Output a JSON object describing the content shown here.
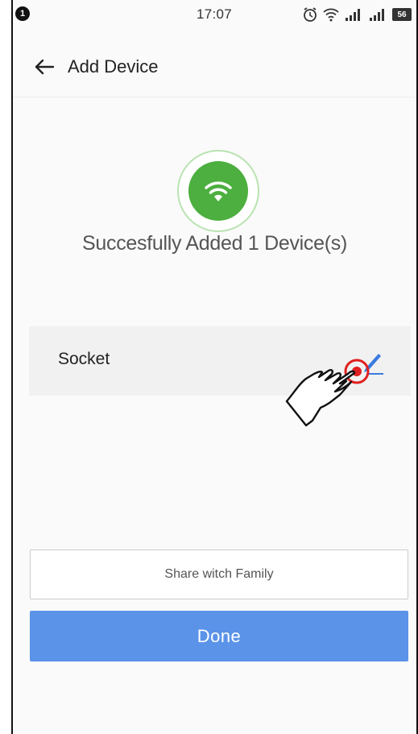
{
  "status_bar": {
    "notification_badge": "1",
    "time": "17:07",
    "battery": "56",
    "icons": [
      "alarm-icon",
      "wifi-icon",
      "signal-icon",
      "signal-icon",
      "battery-icon"
    ]
  },
  "header": {
    "back_icon": "arrow-left-icon",
    "title": "Add Device"
  },
  "success": {
    "icon": "wifi-icon",
    "message": "Succesfully Added 1 Device(s)"
  },
  "device": {
    "name": "Socket",
    "edit_icon": "pencil-icon"
  },
  "buttons": {
    "share_label": "Share witch Family",
    "done_label": "Done"
  },
  "colors": {
    "accent_blue": "#5a93e8",
    "success_green": "#4caf3f",
    "highlight_red": "#e02020"
  }
}
